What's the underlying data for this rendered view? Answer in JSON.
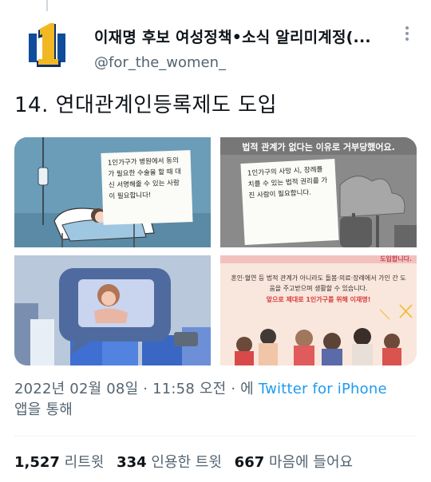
{
  "tweet": {
    "display_name": "이재명 후보 여성정책•소식 알리미계정(...",
    "handle": "@for_the_women_",
    "text": "14. 연대관계인등록제도 도입",
    "timestamp_prefix": "2022년 02월 08일 · 11:58 오전 · 에 ",
    "source": "Twitter for iPhone",
    "timestamp_suffix": "앱을 통해",
    "avatar_glyph": "1"
  },
  "media": {
    "tile1_note": "1인가구가 병원에서 동의가 필요한 수술을 할 때 대신 서명해줄 수 있는 사람이 필요합니다!",
    "tile2_caption": "법적 관계가 없다는 이유로 거부당했어요.",
    "tile2_note": "1인가구의 사망 시, 장례를 치를 수 있는 법적 권리를 가진 사람이 필요합니다.",
    "tile4_banner": "도입합니다.",
    "tile4_body": "혼인·혈연 등 법적 관계가 아니라도 돌봄·의료·장례에서 가인 간 도움을 주고받으며 생활할 수 있습니다.",
    "tile4_red": "앞으로 제대로 1인가구를 위해 이재명!"
  },
  "stats": {
    "retweets_count": "1,527",
    "retweets_label": "리트윗",
    "quotes_count": "334",
    "quotes_label": "인용한 트윗",
    "likes_count": "667",
    "likes_label": "마음에 들어요"
  },
  "colors": {
    "link": "#1d9bf0",
    "secondary_text": "#536471",
    "avatar_gold": "#f2b824",
    "avatar_blue": "#0f4c9b"
  },
  "icons": {
    "more": "more-vertical-icon",
    "avatar": "number-one-logo"
  }
}
